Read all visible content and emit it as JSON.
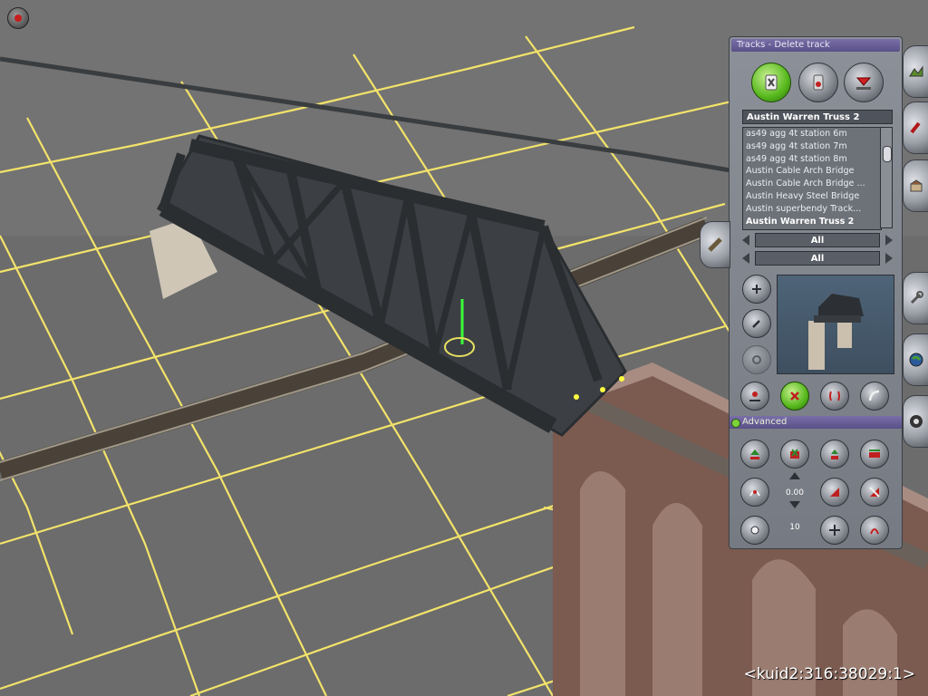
{
  "panel": {
    "title": "Tracks - Delete track",
    "selected_asset": "Austin Warren Truss 2",
    "assets": [
      "as49 agg 4t station 6m",
      "as49 agg 4t station 7m",
      "as49 agg 4t station 8m",
      "Austin Cable Arch Bridge",
      "Austin Cable Arch Bridge ...",
      "Austin Heavy Steel Bridge",
      "Austin superbendy Track...",
      "Austin Warren Truss 2"
    ],
    "filter1": "All",
    "filter2": "All",
    "advanced_label": "Advanced",
    "height_value": "0.00",
    "grid_value": "10"
  },
  "status": {
    "kuid": "<kuid2:316:38029:1>"
  },
  "colors": {
    "grid": "#f3e36a",
    "ground": "#6e6e6e",
    "active_green": "#56b81c",
    "title_bar": "#6a5f98"
  },
  "icons": {
    "record": "record-icon",
    "delete_track": "delete-track-icon",
    "spline": "spline-icon",
    "trackmark": "trackmark-icon",
    "side_tabs": [
      "terrain-icon",
      "paint-icon",
      "objects-icon",
      "tracks-icon",
      "tools-icon",
      "globe-icon",
      "layers-icon"
    ]
  }
}
